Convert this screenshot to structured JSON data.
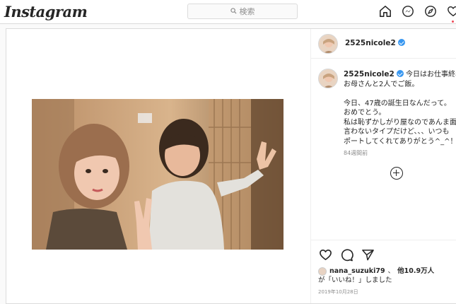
{
  "header": {
    "logo": "Instagram",
    "search_placeholder": "検索"
  },
  "icons": [
    "home-icon",
    "messenger-icon",
    "explore-icon",
    "heart-icon"
  ],
  "post": {
    "username": "2525nicole2",
    "caption_username": "2525nicole2",
    "caption_lines": [
      "今日はお仕事終わり",
      "お母さんと2人でご飯。",
      "",
      "今日、47歳の誕生日なんだって。",
      "おめでとう。",
      "私は恥ずかしがり屋なのであんま面",
      "言わないタイプだけど、、、いつも",
      "ポートしてくれてありがとう^_^！"
    ],
    "time_ago": "84週間前",
    "likes": {
      "user": "nana_suzuki79",
      "separator": "、",
      "others": "他10.9万人",
      "suffix": "が「いいね！」しました"
    },
    "date": "2019年10月28日"
  },
  "colors": {
    "accent": "#3897f0",
    "notification": "#ed4956",
    "border": "#dbdbdb"
  }
}
